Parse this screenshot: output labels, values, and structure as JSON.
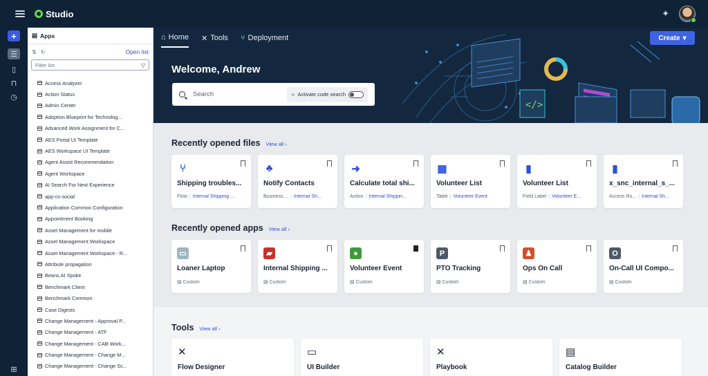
{
  "topbar": {
    "app_title": "Studio"
  },
  "rail": {
    "icons": [
      "add-icon",
      "apps-icon",
      "document-icon",
      "bookmark-icon",
      "history-icon",
      "layout-icon"
    ]
  },
  "sidebar": {
    "header": "Apps",
    "open_list": "Open list",
    "filter_placeholder": "Filter list",
    "items": [
      "Access Analyzer",
      "Action Status",
      "Admin Center",
      "Adoption Blueprint for Technolog...",
      "Advanced Work Assignment for C...",
      "AES Portal UI Template",
      "AES Workspace UI Template",
      "Agent Assist Recommendation",
      "Agent Workspace",
      "AI Search For Next Experience",
      "app-cs-social",
      "Application Common Configuration",
      "Appointment Booking",
      "Asset Management for mobile",
      "Asset Management Workspace",
      "Asset Management Workspace - R...",
      "Attribute propagation",
      "Beans.AI Spoke",
      "Benchmark Client",
      "Benchmark Common",
      "Case Digests",
      "Change Management - Approval P...",
      "Change Management - ATF",
      "Change Management - CAB Work...",
      "Change Management - Change M...",
      "Change Management - Change Sc..."
    ]
  },
  "nav": {
    "tabs": [
      "Home",
      "Tools",
      "Deployment"
    ],
    "create_label": "Create"
  },
  "hero": {
    "welcome": "Welcome, Andrew",
    "search_placeholder": "Search",
    "code_search_label": "Activate code search"
  },
  "recent_files": {
    "title": "Recently opened files",
    "view_all": "View all",
    "items": [
      {
        "title": "Shipping troubles...",
        "type": "Flow",
        "app": "Internal Shipping ...",
        "icon": "flow-icon",
        "color": "#2e4fd6"
      },
      {
        "title": "Notify Contacts",
        "type": "Business ...",
        "app": "Internal Sh...",
        "icon": "hierarchy-icon",
        "color": "#2e4fd6"
      },
      {
        "title": "Calculate total shi...",
        "type": "Action",
        "app": "Internal Shippin...",
        "icon": "action-icon",
        "color": "#2e4fd6"
      },
      {
        "title": "Volunteer List",
        "type": "Table",
        "app": "Volunteer Event",
        "icon": "table-icon",
        "color": "#2e4fd6"
      },
      {
        "title": "Volunteer List",
        "type": "Field Label",
        "app": "Volunteer E...",
        "icon": "file-icon",
        "color": "#2e4fd6"
      },
      {
        "title": "x_snc_internal_s_...",
        "type": "Access Ro...",
        "app": "Internal Sh...",
        "icon": "file-icon",
        "color": "#2e4fd6"
      }
    ]
  },
  "recent_apps": {
    "title": "Recently opened apps",
    "view_all": "View all",
    "items": [
      {
        "title": "Loaner Laptop",
        "meta": "Custom",
        "icon": "laptop-icon",
        "color": "#9fb6c4",
        "glyph": "▭",
        "bookmarked": false
      },
      {
        "title": "Internal Shipping ...",
        "meta": "Custom",
        "icon": "truck-icon",
        "color": "#c6332b",
        "glyph": "▰",
        "bookmarked": false
      },
      {
        "title": "Volunteer Event",
        "meta": "Custom",
        "icon": "globe-icon",
        "color": "#3f9a3c",
        "glyph": "●",
        "bookmarked": true
      },
      {
        "title": "PTO Tracking",
        "meta": "Custom",
        "icon": "letter-p-icon",
        "color": "#4d5a66",
        "glyph": "P",
        "bookmarked": false
      },
      {
        "title": "Ops On Call",
        "meta": "Custom",
        "icon": "character-icon",
        "color": "#d4512a",
        "glyph": "♟",
        "bookmarked": false
      },
      {
        "title": "On-Call UI Compo...",
        "meta": "Custom",
        "icon": "letter-o-icon",
        "color": "#4d5a66",
        "glyph": "O",
        "bookmarked": false
      }
    ]
  },
  "tools": {
    "title": "Tools",
    "view_all": "View all",
    "items": [
      {
        "title": "Flow Designer",
        "icon": "tools-icon",
        "glyph": "✕"
      },
      {
        "title": "UI Builder",
        "icon": "monitor-icon",
        "glyph": "▭"
      },
      {
        "title": "Playbook",
        "icon": "tools-icon",
        "glyph": "✕"
      },
      {
        "title": "Catalog Builder",
        "icon": "catalog-icon",
        "glyph": "▤"
      }
    ]
  }
}
